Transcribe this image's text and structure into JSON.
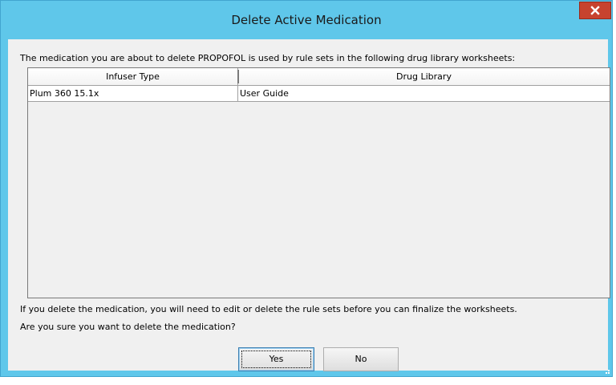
{
  "window": {
    "title": "Delete Active Medication",
    "close_icon": "close-icon",
    "colors": {
      "titlebar": "#5fc7ea",
      "close_button": "#c7432f",
      "client": "#f0f0f0"
    }
  },
  "message": "The medication you are about to delete PROPOFOL is used by rule sets in the following drug library worksheets:",
  "table": {
    "columns": [
      "Infuser Type",
      "Drug Library"
    ],
    "rows": [
      [
        "Plum 360 15.1x",
        "User Guide"
      ]
    ]
  },
  "info": {
    "line1": "If you delete the medication, you will need to edit or delete the rule sets before you can finalize the worksheets.",
    "line2": "Are you sure you want to delete the medication?"
  },
  "buttons": {
    "yes_label": "Yes",
    "no_label": "No"
  }
}
